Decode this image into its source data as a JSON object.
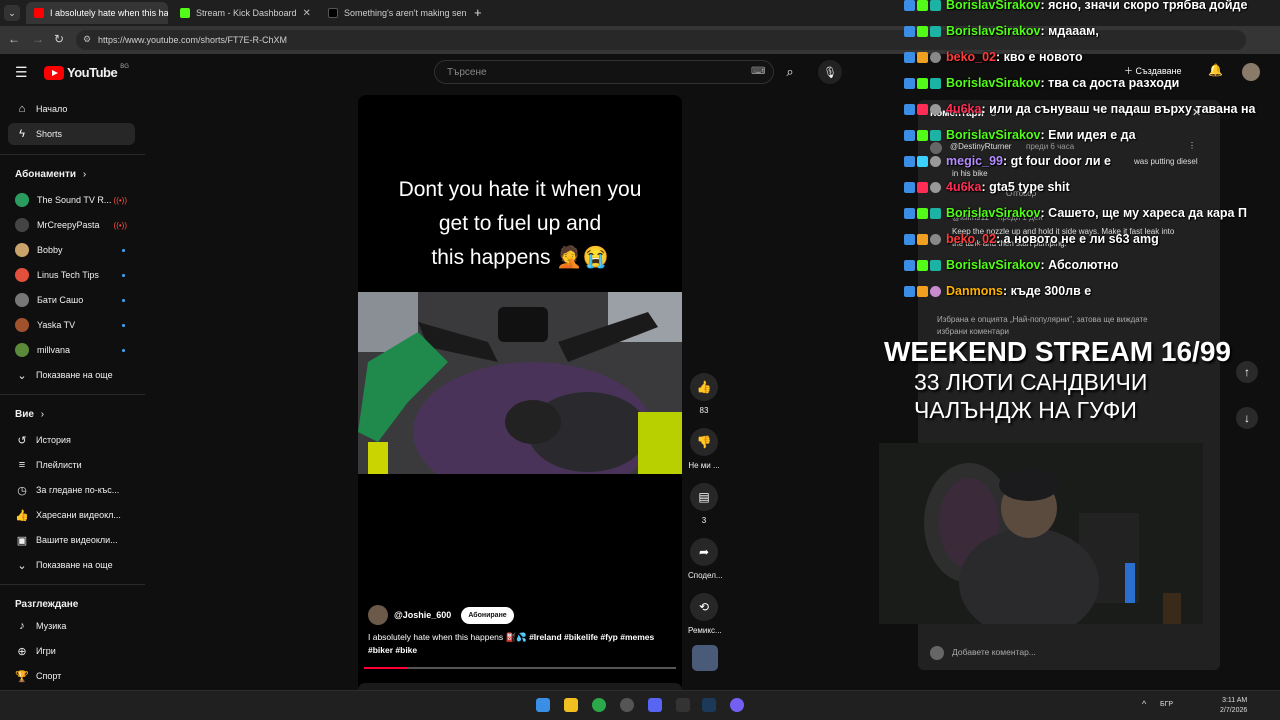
{
  "browser": {
    "tabs": [
      {
        "title": "I absolutely hate when this hap",
        "close": "✕",
        "fav_color": "#ff0000"
      },
      {
        "title": "Stream - Kick Dashboard",
        "close": "✕",
        "fav_color": "#53fc18"
      },
      {
        "title": "Something's aren't making sen",
        "close": "✕",
        "fav_color": "#000000"
      }
    ],
    "new_tab": "+",
    "url": "https://www.youtube.com/shorts/FT7E-R-ChXM"
  },
  "youtube": {
    "logo_text": "YouTube",
    "country": "BG",
    "search_placeholder": "Търсене",
    "create_label": "Създаване"
  },
  "sidebar": {
    "main": [
      {
        "label": "Начало",
        "icon": "home-icon"
      },
      {
        "label": "Shorts",
        "icon": "shorts-icon"
      }
    ],
    "subs_header": "Абонаменти",
    "subscriptions": [
      {
        "label": "The Sound TV R...",
        "color": "#2b9c5f",
        "indicator": "live"
      },
      {
        "label": "MrCreepyPasta",
        "color": "#444444",
        "indicator": "live"
      },
      {
        "label": "Bobby",
        "color": "#c8a36a",
        "indicator": "dot"
      },
      {
        "label": "Linus Tech Tips",
        "color": "#e0503c",
        "indicator": "dot"
      },
      {
        "label": "Бати Сашо",
        "color": "#777777",
        "indicator": "dot"
      },
      {
        "label": "Yaska TV",
        "color": "#a0522d",
        "indicator": "dot"
      },
      {
        "label": "millvana",
        "color": "#5a8a3a",
        "indicator": "dot"
      }
    ],
    "show_more_subs": "Показване на още",
    "you_header": "Вие",
    "you_items": [
      {
        "label": "История",
        "icon": "history-icon"
      },
      {
        "label": "Плейлисти",
        "icon": "playlists-icon"
      },
      {
        "label": "За гледане по-къс...",
        "icon": "watch-later-icon"
      },
      {
        "label": "Харесани видеокл...",
        "icon": "liked-icon"
      },
      {
        "label": "Вашите видеокли...",
        "icon": "your-videos-icon"
      }
    ],
    "show_more_you": "Показване на още",
    "explore_header": "Разглеждане",
    "explore_items": [
      {
        "label": "Музика",
        "icon": "music-icon"
      },
      {
        "label": "Игри",
        "icon": "games-icon"
      },
      {
        "label": "Спорт",
        "icon": "sport-icon"
      }
    ]
  },
  "short": {
    "caption_line1": "Dont you hate it when you",
    "caption_line2": "get to fuel up and",
    "caption_line3": "this happens 🤦😭",
    "channel": "@Joshie_600",
    "subscribe": "Абониране",
    "description": "I absolutely hate when this happens ⛽💦",
    "hashtags": "#Ireland #bikelife #fyp #memes #biker #bike",
    "progress_percent": 14
  },
  "actions": {
    "likes": "83",
    "dislike": "Не ми ...",
    "comments": "3",
    "share": "Сподел...",
    "remix": "Ремикс..."
  },
  "chat": [
    {
      "user": "BorislavSirakov",
      "color": "#53fc18",
      "msg": ": ясно, значи скоро трябва дойде"
    },
    {
      "user": "BorislavSirakov",
      "color": "#53fc18",
      "msg": ": мдааам,"
    },
    {
      "user": "beko_02",
      "color": "#ff3b3b",
      "msg": ": кво е новото"
    },
    {
      "user": "BorislavSirakov",
      "color": "#53fc18",
      "msg": ": тва са доста разходи"
    },
    {
      "user": "4u6ka",
      "color": "#ff2d55",
      "msg": ": или да сънуваш че падаш върху тавана на"
    },
    {
      "user": "BorislavSirakov",
      "color": "#53fc18",
      "msg": ": Еми идея е да"
    },
    {
      "user": "megic_99",
      "color": "#b48cff",
      "msg": ": gt four door ли е"
    },
    {
      "user": "4u6ka",
      "color": "#ff2d55",
      "msg": ": gta5 type shit"
    },
    {
      "user": "BorislavSirakov",
      "color": "#53fc18",
      "msg": ": Сашето, ще му хареса да кара П"
    },
    {
      "user": "beko_02",
      "color": "#ff3b3b",
      "msg": ": а новото не е ли s63 amg"
    },
    {
      "user": "BorislavSirakov",
      "color": "#53fc18",
      "msg": ": Абсолютно"
    },
    {
      "user": "Danmons",
      "color": "#ffb300",
      "msg": ": къде 300лв е"
    }
  ],
  "comments": {
    "title": "Коментари",
    "count": "3",
    "c1_user": "@DestinyRturner",
    "c1_time": "преди 6 часа",
    "c1_text_a": "was putting diesel",
    "c1_text_b": "in his bike",
    "reply": "Отговор",
    "c2_user": "@kilim911",
    "c2_time": "преди 1 ден",
    "c2_text_a": "Keep the nozzle up and hold it side ways. Make it fast leak into",
    "c2_text_b": "the tank and then start pumping.",
    "notice_a": "Избрана е опцията „Най-популярни\", затова ще виждате",
    "notice_b": "избрани коментари",
    "add_placeholder": "Добавете коментар..."
  },
  "overlay": {
    "title": "WEEKEND STREAM 16/99",
    "line1": "33 ЛЮТИ САНДВИЧИ",
    "line2": "ЧАЛЪНДЖ НА ГУФИ"
  },
  "taskbar": {
    "lang": "БГР",
    "time": "3:11 AM",
    "date": "2/7/2026"
  }
}
